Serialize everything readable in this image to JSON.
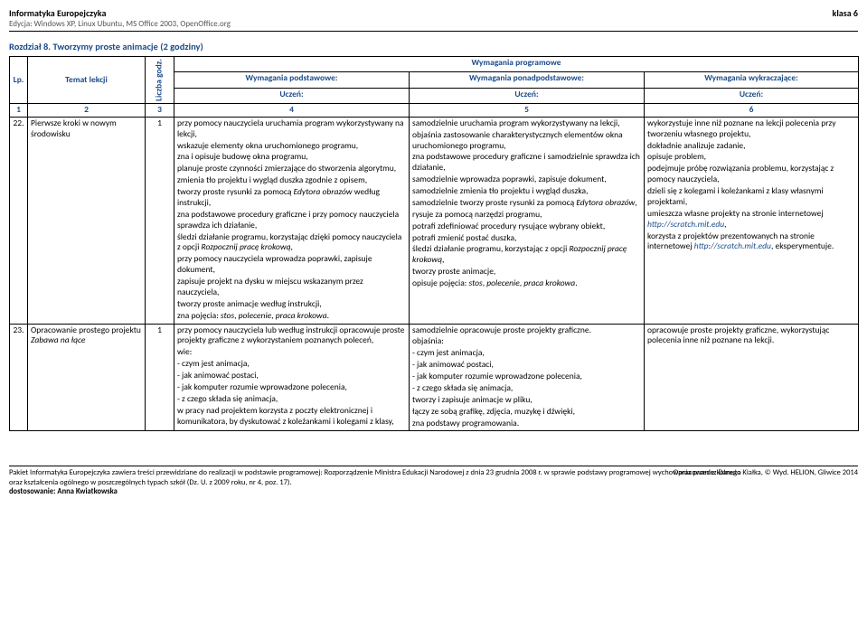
{
  "header": {
    "title": "Informatyka Europejczyka",
    "subtitle": "Edycja: Windows XP, Linux Ubuntu, MS Office 2003, OpenOffice.org",
    "klasa": "klasa 6"
  },
  "chapter": "Rozdział 8. Tworzymy proste animacje (2 godziny)",
  "tableHeaders": {
    "lp": "Lp.",
    "topic": "Temat lekcji",
    "hours": "Liczba godz.",
    "programowe": "Wymagania programowe",
    "podstawowe": "Wymagania podstawowe:",
    "ponad": "Wymagania ponadpodstawowe:",
    "wykracz": "Wymagania wykraczające:",
    "uczen": "Uczeń:",
    "n1": "1",
    "n2": "2",
    "n3": "3",
    "n4": "4",
    "n5": "5",
    "n6": "6"
  },
  "rows": [
    {
      "lp": "22.",
      "topic": "Pierwsze kroki w nowym środowisku",
      "hours": "1",
      "col4": [
        "przy pomocy nauczyciela uruchamia program wykorzystywany na lekcji,",
        "wskazuje elementy okna uruchomionego programu,",
        "zna i opisuje budowę okna programu,",
        "planuje proste czynności zmierzające do stworzenia algorytmu,",
        "zmienia tło projektu i wygląd duszka zgodnie z opisem,",
        "tworzy proste rysunki za pomocą <span class=\"ital\">Edytora obrazów</span> według instrukcji,",
        "zna podstawowe procedury graficzne i przy pomocy nauczyciela sprawdza ich działanie,",
        "śledzi działanie programu, korzystając dzięki pomocy nauczyciela z opcji <span class=\"ital\">Rozpocznij pracę krokową</span>,",
        "przy pomocy nauczyciela wprowadza poprawki, zapisuje dokument,",
        "zapisuje projekt na dysku w miejscu wskazanym przez nauczyciela,",
        "tworzy proste animacje według instrukcji,",
        "zna pojęcia: <span class=\"ital\">stos</span>, <span class=\"ital\">polecenie</span>, <span class=\"ital\">praca krokowa</span>."
      ],
      "col5": [
        "samodzielnie uruchamia program wykorzystywany na lekcji,",
        "objaśnia zastosowanie charakterystycznych elementów okna uruchomionego programu,",
        "zna podstawowe procedury graficzne i samodzielnie sprawdza ich działanie,",
        "samodzielnie wprowadza poprawki, zapisuje dokument,",
        "samodzielnie zmienia tło projektu i wygląd duszka,",
        "samodzielnie tworzy proste rysunki za pomocą <span class=\"ital\">Edytora obrazów</span>,",
        "rysuje za pomocą narzędzi programu,",
        "potrafi zdefiniować procedury rysujące wybrany obiekt,",
        "potrafi zmienić postać duszka,",
        "śledzi działanie programu, korzystając z opcji <span class=\"ital\">Rozpocznij pracę krokową</span>,",
        "tworzy proste animacje,",
        "opisuje pojęcia: <span class=\"ital\">stos</span>, <span class=\"ital\">polecenie</span>, <span class=\"ital\">praca krokowa</span>."
      ],
      "col6": [
        "wykorzystuje inne niż poznane na lekcji polecenia przy tworzeniu własnego projektu,",
        "dokładnie analizuje zadanie,",
        "opisuje problem,",
        "podejmuje próbę rozwiązania problemu, korzystając z pomocy nauczyciela,",
        "dzieli się z kolegami i koleżankami z klasy własnymi projektami,",
        "umieszcza własne projekty na stronie internetowej <span class=\"link\">http://scratch.mit.edu</span>,",
        "korzysta z projektów prezentowanych na stronie internetowej <span class=\"link\">http://scratch.mit.edu</span>, eksperymentuje."
      ]
    },
    {
      "lp": "23.",
      "topic": "Opracowanie prostego projektu <span class=\"ital\">Zabawa na łące</span>",
      "hours": "1",
      "col4": [
        "przy pomocy nauczyciela lub według instrukcji opracowuje proste projekty graficzne z wykorzystaniem poznanych poleceń,",
        "wie:",
        "- czym jest animacja,",
        "- jak animować postaci,",
        "- jak komputer rozumie wprowadzone polecenia,",
        "- z czego składa się animacja,",
        "w pracy nad projektem korzysta z poczty elektronicznej i komunikatora, by dyskutować z koleżankami i kolegami z klasy,"
      ],
      "col5": [
        "samodzielnie opracowuje proste projekty graficzne.",
        "objaśnia:",
        "- czym jest animacja,",
        "- jak animować postaci,",
        "- jak komputer rozumie wprowadzone polecenia,",
        "- z czego składa się animacja,",
        "tworzy i zapisuje animacje w pliku,",
        "łączy ze sobą grafikę, zdjęcia, muzykę i dźwięki,",
        "zna podstawy programowania."
      ],
      "col6": [
        "opracowuje proste projekty graficzne, wykorzystując polecenia inne niż poznane na lekcji."
      ]
    }
  ],
  "footer": {
    "line1a": "Pakiet Informatyka Europejczyka zawiera treści przewidziane do realizacji w podstawie programowej: Rozporządzenie Ministra Edukacji Narodowej z dnia 23 grudnia 2008 r. w sprawie podstawy programowej wychowania przedszkolnego",
    "line1b": "oraz kształcenia ogólnego w poszczególnych typach szkół (Dz. U. z 2009 roku, nr 4, poz. 17).",
    "line2": "dostosowanie: Anna Kwiatkowska",
    "right": "Opracowanie: Danuta Kiałka, © Wyd. HELION, Gliwice 2014"
  }
}
